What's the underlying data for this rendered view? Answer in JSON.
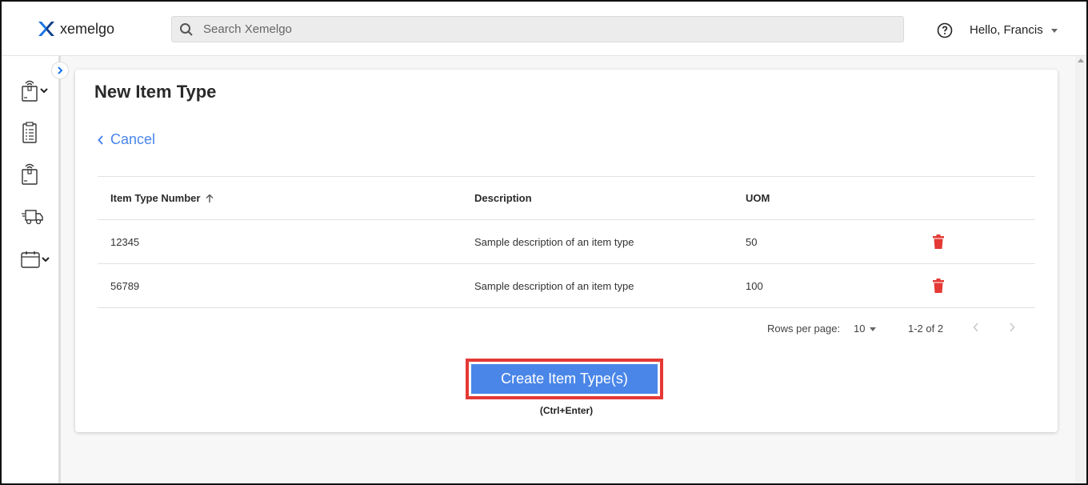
{
  "header": {
    "brand": "xemelgo",
    "search_placeholder": "Search Xemelgo",
    "greeting": "Hello, Francis"
  },
  "sidebar": {
    "items": [
      {
        "icon": "rfid-tag-icon",
        "has_dropdown": true
      },
      {
        "icon": "clipboard-list-icon",
        "has_dropdown": false
      },
      {
        "icon": "rfid-tag-icon",
        "has_dropdown": false
      },
      {
        "icon": "delivery-truck-icon",
        "has_dropdown": false
      },
      {
        "icon": "calendar-icon",
        "has_dropdown": true
      }
    ]
  },
  "page": {
    "title": "New Item Type",
    "cancel_label": "Cancel"
  },
  "table": {
    "columns": [
      "Item Type Number",
      "Description",
      "UOM"
    ],
    "rows": [
      {
        "number": "12345",
        "description": "Sample description of an item type",
        "uom": "50"
      },
      {
        "number": "56789",
        "description": "Sample description of an item type",
        "uom": "100"
      }
    ]
  },
  "pagination": {
    "rows_per_page_label": "Rows per page:",
    "rows_per_page_value": "10",
    "range": "1-2 of 2"
  },
  "actions": {
    "create_label": "Create Item Type(s)",
    "shortcut": "(Ctrl+Enter)"
  },
  "colors": {
    "accent": "#4a86e8",
    "delete": "#e53935",
    "highlight_border": "#e53935"
  }
}
